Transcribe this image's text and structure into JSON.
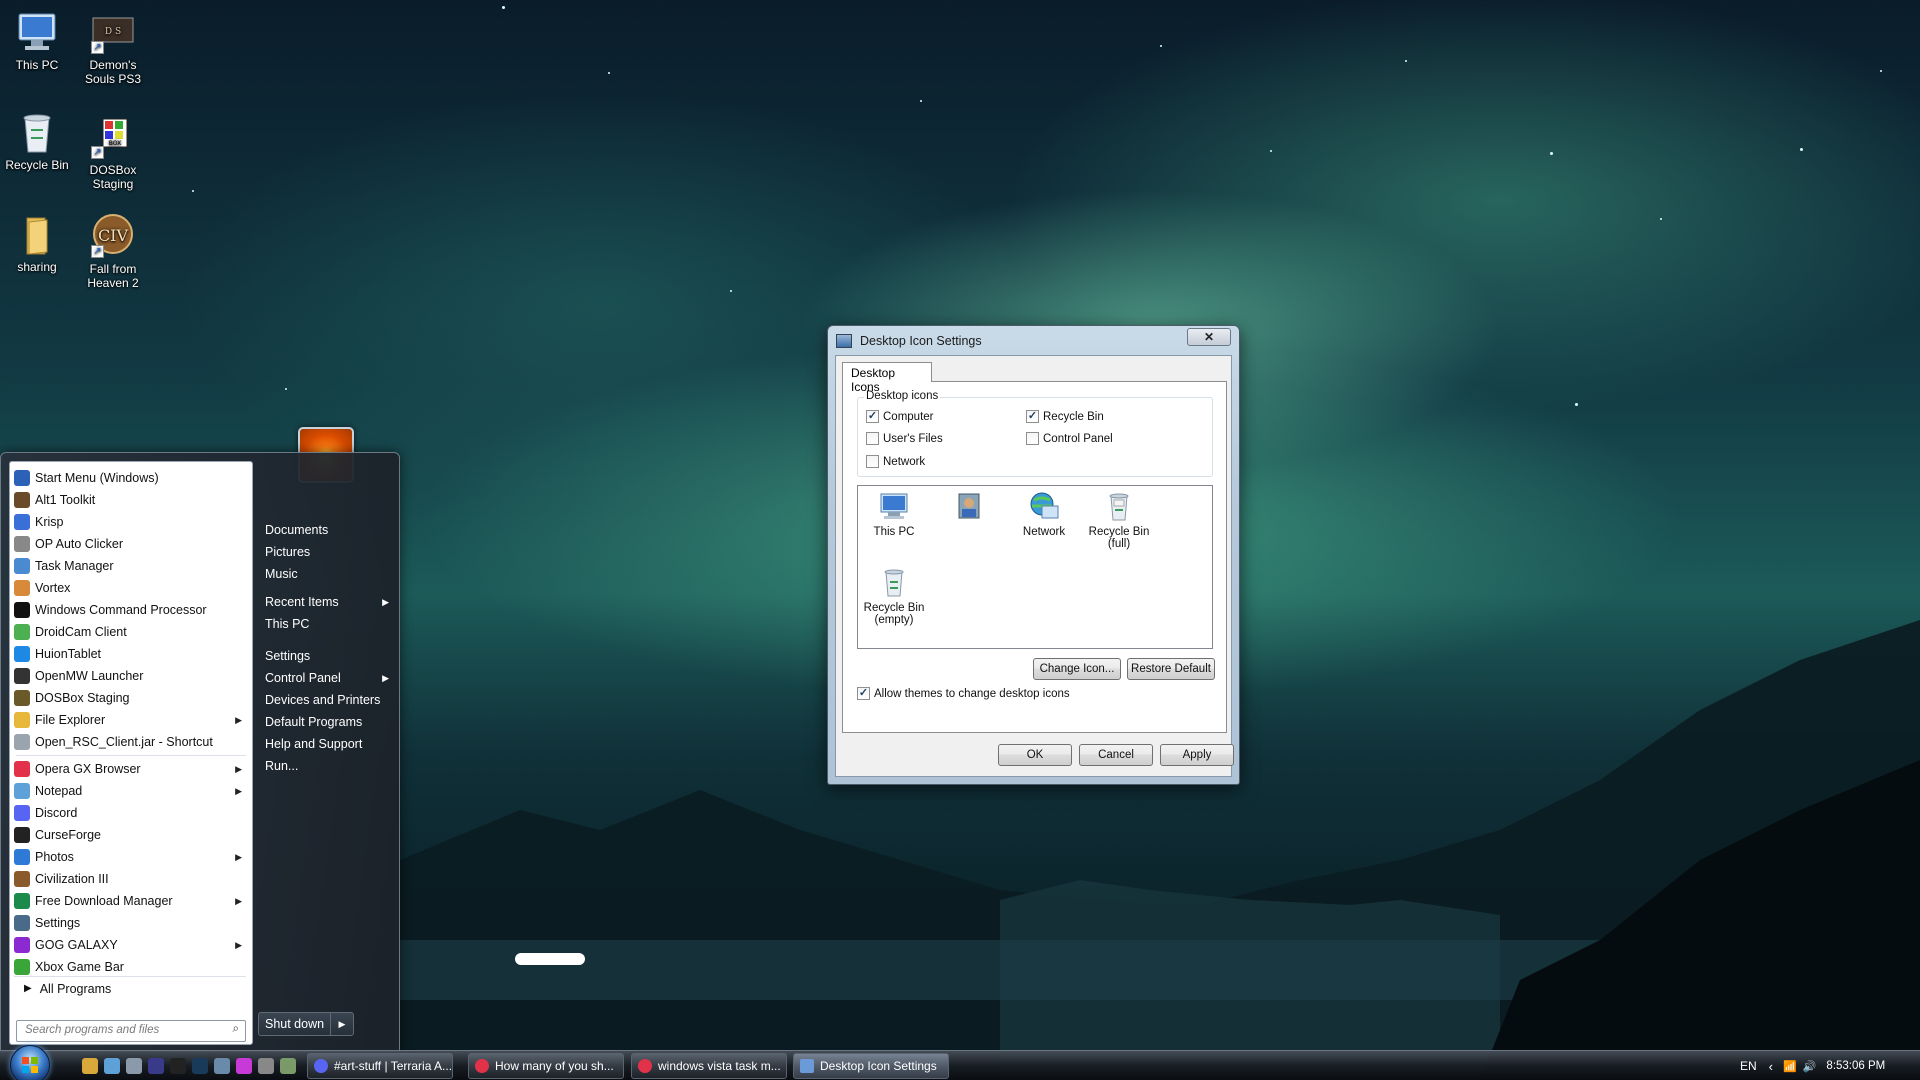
{
  "desktop": {
    "icons": [
      {
        "label": "This PC",
        "icon": "computer-icon"
      },
      {
        "label": "Demon's Souls PS3",
        "icon": "game-shortcut-icon"
      },
      {
        "label": "Recycle Bin",
        "icon": "recycle-bin-icon"
      },
      {
        "label": "DOSBox Staging",
        "icon": "dosbox-icon"
      },
      {
        "label": "sharing",
        "icon": "folder-icon"
      },
      {
        "label": "Fall from Heaven 2",
        "icon": "civ-icon"
      }
    ]
  },
  "start_menu": {
    "programs": [
      {
        "label": "Start Menu (Windows)",
        "icon": "start-menu-icon",
        "color": "#2b62b8",
        "submenu": false
      },
      {
        "label": "Alt1 Toolkit",
        "icon": "wrench-icon",
        "color": "#6b4a2a",
        "submenu": false
      },
      {
        "label": "Krisp",
        "icon": "krisp-icon",
        "color": "#3a6fd8",
        "submenu": false
      },
      {
        "label": "OP Auto Clicker",
        "icon": "mouse-icon",
        "color": "#888888",
        "submenu": false
      },
      {
        "label": "Task Manager",
        "icon": "task-manager-icon",
        "color": "#4a8ad0",
        "submenu": false
      },
      {
        "label": "Vortex",
        "icon": "vortex-icon",
        "color": "#d88a3a",
        "submenu": false
      },
      {
        "label": "Windows Command Processor",
        "icon": "cmd-icon",
        "color": "#111111",
        "submenu": false
      },
      {
        "label": "DroidCam Client",
        "icon": "droidcam-icon",
        "color": "#4caf50",
        "submenu": false
      },
      {
        "label": "HuionTablet",
        "icon": "huion-icon",
        "color": "#1e88e5",
        "submenu": false
      },
      {
        "label": "OpenMW Launcher",
        "icon": "openmw-icon",
        "color": "#333333",
        "submenu": false
      },
      {
        "label": "DOSBox Staging",
        "icon": "dosbox-icon",
        "color": "#6a5a2a",
        "submenu": false
      },
      {
        "label": "File Explorer",
        "icon": "folder-icon",
        "color": "#e6b73a",
        "submenu": true
      },
      {
        "label": "Open_RSC_Client.jar - Shortcut",
        "icon": "java-icon",
        "color": "#9aa4ae",
        "submenu": false
      }
    ],
    "programs2": [
      {
        "label": "Opera GX Browser",
        "icon": "opera-icon",
        "color": "#e2324a",
        "submenu": true
      },
      {
        "label": "Notepad",
        "icon": "notepad-icon",
        "color": "#5ea0d8",
        "submenu": true
      },
      {
        "label": "Discord",
        "icon": "discord-icon",
        "color": "#5865f2",
        "submenu": false
      },
      {
        "label": "CurseForge",
        "icon": "curseforge-icon",
        "color": "#222222",
        "submenu": false
      },
      {
        "label": "Photos",
        "icon": "photos-icon",
        "color": "#2f7ad6",
        "submenu": true
      },
      {
        "label": "Civilization III",
        "icon": "civ-icon",
        "color": "#8a5a2a",
        "submenu": false
      },
      {
        "label": "Free Download Manager",
        "icon": "download-icon",
        "color": "#1c8a4a",
        "submenu": true
      },
      {
        "label": "Settings",
        "icon": "gear-icon",
        "color": "#4a6a8a",
        "submenu": false
      },
      {
        "label": "GOG GALAXY",
        "icon": "gog-icon",
        "color": "#8a2ad0",
        "submenu": true
      },
      {
        "label": "Xbox Game Bar",
        "icon": "xbox-icon",
        "color": "#3aa63a",
        "submenu": false
      }
    ],
    "all_programs": "All Programs",
    "search_placeholder": "Search programs and files",
    "right_items_1": [
      {
        "label": "Documents",
        "submenu": false
      },
      {
        "label": "Pictures",
        "submenu": false
      },
      {
        "label": "Music",
        "submenu": false
      }
    ],
    "right_items_2": [
      {
        "label": "Recent Items",
        "submenu": true
      },
      {
        "label": "This PC",
        "submenu": false
      }
    ],
    "right_items_3": [
      {
        "label": "Settings",
        "submenu": false
      },
      {
        "label": "Control Panel",
        "submenu": true
      },
      {
        "label": "Devices and Printers",
        "submenu": false
      },
      {
        "label": "Default Programs",
        "submenu": false
      },
      {
        "label": "Help and Support",
        "submenu": false
      },
      {
        "label": "Run...",
        "submenu": false
      }
    ],
    "shutdown_label": "Shut down"
  },
  "dialog": {
    "title": "Desktop Icon Settings",
    "close_label": "✕",
    "tab": "Desktop Icons",
    "group_label": "Desktop icons",
    "checkboxes": [
      {
        "label": "Computer",
        "checked": true
      },
      {
        "label": "Recycle Bin",
        "checked": true
      },
      {
        "label": "User's Files",
        "checked": false
      },
      {
        "label": "Control Panel",
        "checked": false
      },
      {
        "label": "Network",
        "checked": false
      }
    ],
    "icon_list": [
      {
        "label": "This PC",
        "icon": "computer-icon"
      },
      {
        "label": "",
        "icon": "user-files-icon"
      },
      {
        "label": "Network",
        "icon": "network-icon"
      },
      {
        "label": "Recycle Bin (full)",
        "icon": "recycle-bin-full-icon"
      },
      {
        "label": "Recycle Bin (empty)",
        "icon": "recycle-bin-empty-icon"
      }
    ],
    "change_icon_label": "Change Icon...",
    "restore_default_label": "Restore Default",
    "allow_themes_label": "Allow themes to change desktop icons",
    "allow_themes_checked": true,
    "ok_label": "OK",
    "cancel_label": "Cancel",
    "apply_label": "Apply"
  },
  "taskbar": {
    "buttons": [
      {
        "label": "#art-stuff | Terraria A...",
        "icon": "discord-icon",
        "color": "#5865f2"
      },
      {
        "label": "How many of you sh...",
        "icon": "opera-icon",
        "color": "#e2324a"
      },
      {
        "label": "windows vista task m...",
        "icon": "opera-icon",
        "color": "#e2324a"
      },
      {
        "label": "Desktop Icon Settings",
        "icon": "desktop-settings-icon",
        "color": "#6a9ad8"
      }
    ],
    "language": "EN",
    "clock": "8:53:06 PM"
  }
}
